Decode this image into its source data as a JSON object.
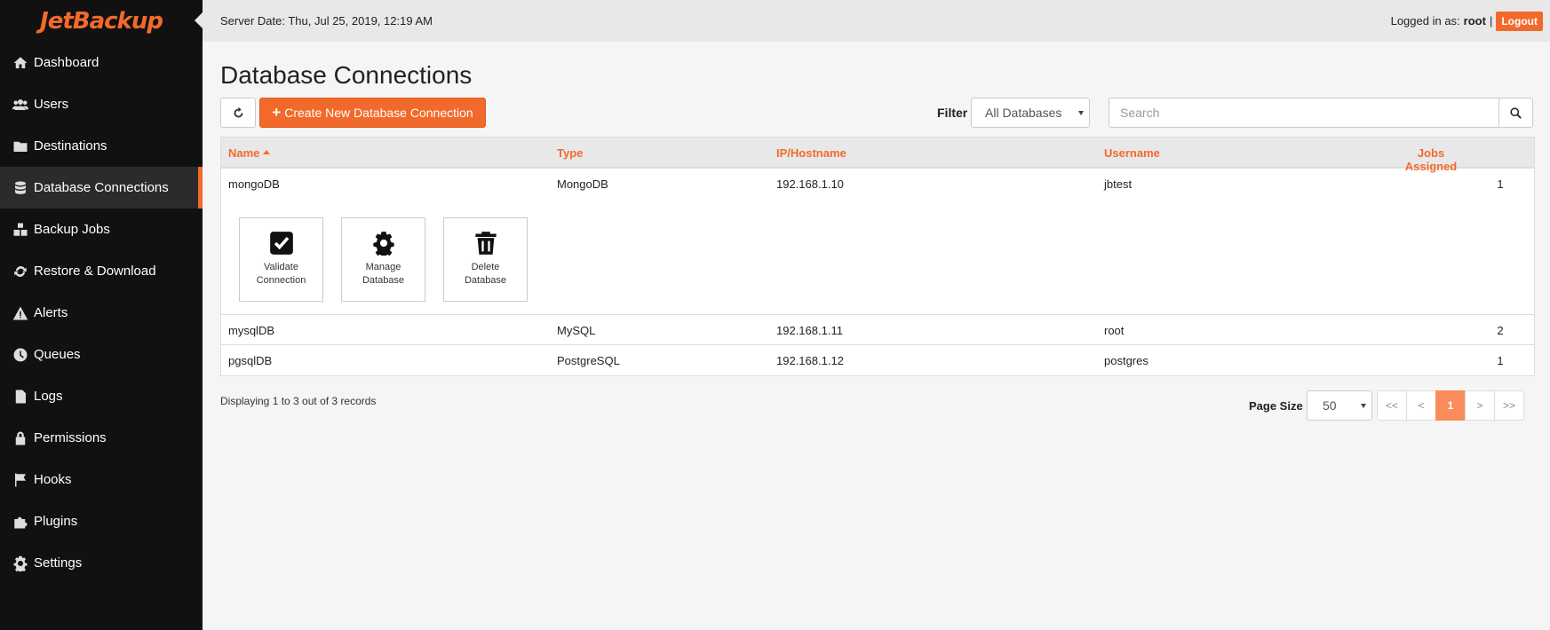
{
  "app": {
    "logo": "JetBackup"
  },
  "colors": {
    "accent": "#f26a2b",
    "sidebar_bg": "#111111",
    "active_page": "#f98c5a"
  },
  "sidebar": {
    "items": [
      {
        "label": "Dashboard",
        "icon": "home-icon"
      },
      {
        "label": "Users",
        "icon": "users-icon"
      },
      {
        "label": "Destinations",
        "icon": "folder-icon"
      },
      {
        "label": "Database Connections",
        "icon": "database-icon",
        "active": true
      },
      {
        "label": "Backup Jobs",
        "icon": "cubes-icon"
      },
      {
        "label": "Restore & Download",
        "icon": "refresh-icon"
      },
      {
        "label": "Alerts",
        "icon": "warning-icon"
      },
      {
        "label": "Queues",
        "icon": "clock-icon"
      },
      {
        "label": "Logs",
        "icon": "file-icon"
      },
      {
        "label": "Permissions",
        "icon": "lock-icon"
      },
      {
        "label": "Hooks",
        "icon": "flag-icon"
      },
      {
        "label": "Plugins",
        "icon": "puzzle-icon"
      },
      {
        "label": "Settings",
        "icon": "gear-icon"
      }
    ]
  },
  "header": {
    "server_date": "Server Date: Thu, Jul 25, 2019, 12:19 AM",
    "logged_in_label": "Logged in as:",
    "username": "root",
    "separator": "|",
    "logout": "Logout"
  },
  "main": {
    "title": "Database Connections",
    "create_button": "Create New Database Connection",
    "filter_label": "Filter",
    "filter_value": "All Databases",
    "search_placeholder": "Search"
  },
  "table": {
    "columns": {
      "name": "Name",
      "type": "Type",
      "ip": "IP/Hostname",
      "username": "Username",
      "jobs": "Jobs Assigned"
    },
    "rows": [
      {
        "name": "mongoDB",
        "type": "MongoDB",
        "ip": "192.168.1.10",
        "username": "jbtest",
        "jobs": "1"
      },
      {
        "name": "mysqlDB",
        "type": "MySQL",
        "ip": "192.168.1.11",
        "username": "root",
        "jobs": "2"
      },
      {
        "name": "pgsqlDB",
        "type": "PostgreSQL",
        "ip": "192.168.1.12",
        "username": "postgres",
        "jobs": "1"
      }
    ],
    "actions": {
      "validate": "Validate Connection",
      "manage": "Manage Database",
      "delete": "Delete Database"
    }
  },
  "footer": {
    "records": "Displaying 1 to 3 out of 3 records",
    "page_size_label": "Page Size",
    "page_size": "50",
    "pager": {
      "first": "<<",
      "prev": "<",
      "current": "1",
      "next": ">",
      "last": ">>"
    }
  }
}
